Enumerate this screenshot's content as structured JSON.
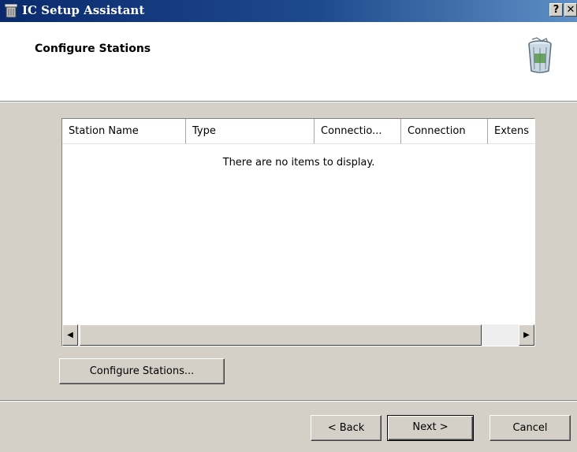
{
  "window": {
    "title": "IC Setup Assistant",
    "help_label": "?",
    "close_label": "✕"
  },
  "header": {
    "title": "Configure Stations",
    "icon": "recycle-bin-icon"
  },
  "listview": {
    "columns": [
      "Station Name",
      "Type",
      "Connectio...",
      "Connection",
      "Extens"
    ],
    "empty_message": "There are no items to display.",
    "scroll_left": "◀",
    "scroll_right": "▶"
  },
  "buttons": {
    "configure": "Configure Stations...",
    "back": "< Back",
    "next": "Next >",
    "cancel": "Cancel"
  },
  "colors": {
    "titlebar_start": "#0b2a6e",
    "titlebar_end": "#5f8fc6",
    "dialog_bg": "#d4d0c8"
  }
}
